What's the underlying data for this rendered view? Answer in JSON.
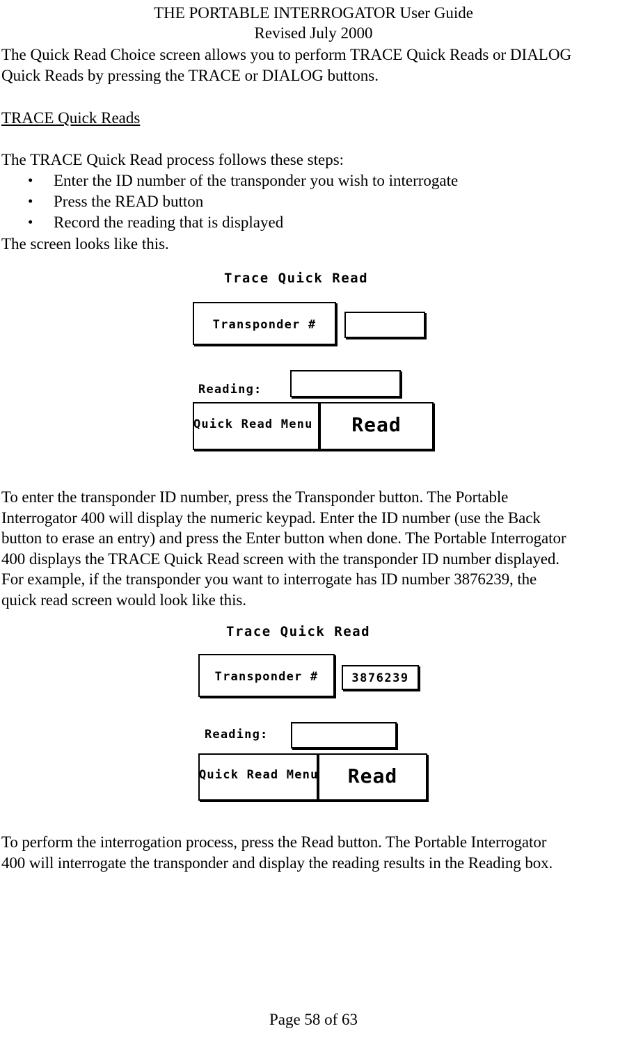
{
  "header": {
    "title_line1": "THE PORTABLE INTERROGATOR User Guide",
    "title_line2": "Revised July 2000"
  },
  "intro": {
    "paragraph_line1": "The Quick Read Choice screen allows you to perform TRACE Quick Reads or DIALOG",
    "paragraph_line2": "Quick Reads by pressing the TRACE or DIALOG buttons."
  },
  "section": {
    "heading": "TRACE Quick Reads",
    "lead_in": "The TRACE Quick Read process follows these steps:",
    "steps": [
      {
        "bullet": "•",
        "text": "Enter the ID number of the transponder you wish to interrogate"
      },
      {
        "bullet": "•",
        "text": "Press the READ button"
      },
      {
        "bullet": "•",
        "text": "Record the reading that is displayed"
      }
    ],
    "after_steps": "The screen looks like this."
  },
  "screen_empty": {
    "title": "Trace Quick Read",
    "transponder_button_label": "Transponder #",
    "transponder_value": "",
    "reading_label": "Reading:",
    "reading_value": "",
    "quick_read_menu_button_label": "Quick Read Menu",
    "read_button_label": "Read"
  },
  "middle_text": {
    "lines": [
      "To enter the transponder ID number, press the Transponder button.  The Portable",
      "Interrogator 400 will display the numeric keypad.  Enter the ID number (use the Back",
      "button to erase an entry) and press the Enter button when done.  The Portable Interrogator",
      "400 displays the TRACE Quick Read screen with the transponder ID number displayed.",
      "For example, if the transponder you want to interrogate has ID number 3876239, the",
      "quick read screen would look like this."
    ]
  },
  "screen_filled": {
    "title": "Trace Quick Read",
    "transponder_button_label": "Transponder #",
    "transponder_value": "3876239",
    "reading_label": "Reading:",
    "reading_value": "",
    "quick_read_menu_button_label": "Quick Read Menu",
    "read_button_label": "Read"
  },
  "closing_text": {
    "lines": [
      "To perform the interrogation process, press the Read button.  The Portable Interrogator",
      "400 will interrogate the transponder and display the reading results in the Reading box."
    ]
  },
  "footer": {
    "page_label": "Page 58 of 63"
  }
}
